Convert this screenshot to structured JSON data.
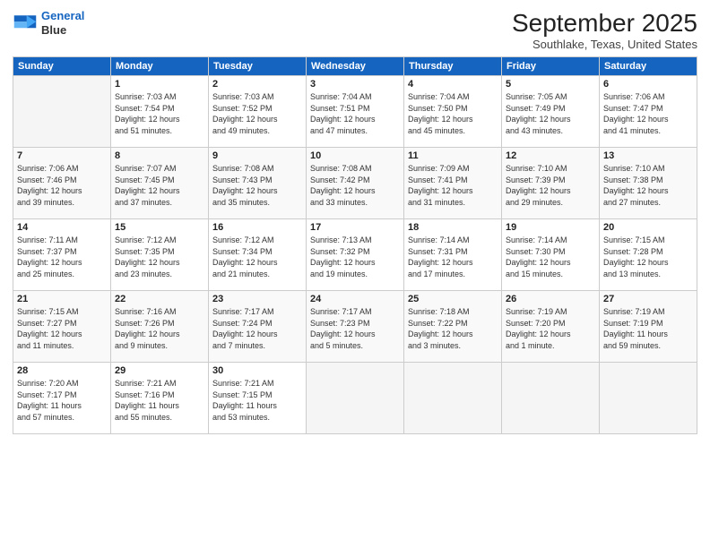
{
  "header": {
    "logo_line1": "General",
    "logo_line2": "Blue",
    "month_title": "September 2025",
    "location": "Southlake, Texas, United States"
  },
  "days_of_week": [
    "Sunday",
    "Monday",
    "Tuesday",
    "Wednesday",
    "Thursday",
    "Friday",
    "Saturday"
  ],
  "weeks": [
    [
      {
        "day": "",
        "info": ""
      },
      {
        "day": "1",
        "info": "Sunrise: 7:03 AM\nSunset: 7:54 PM\nDaylight: 12 hours\nand 51 minutes."
      },
      {
        "day": "2",
        "info": "Sunrise: 7:03 AM\nSunset: 7:52 PM\nDaylight: 12 hours\nand 49 minutes."
      },
      {
        "day": "3",
        "info": "Sunrise: 7:04 AM\nSunset: 7:51 PM\nDaylight: 12 hours\nand 47 minutes."
      },
      {
        "day": "4",
        "info": "Sunrise: 7:04 AM\nSunset: 7:50 PM\nDaylight: 12 hours\nand 45 minutes."
      },
      {
        "day": "5",
        "info": "Sunrise: 7:05 AM\nSunset: 7:49 PM\nDaylight: 12 hours\nand 43 minutes."
      },
      {
        "day": "6",
        "info": "Sunrise: 7:06 AM\nSunset: 7:47 PM\nDaylight: 12 hours\nand 41 minutes."
      }
    ],
    [
      {
        "day": "7",
        "info": "Sunrise: 7:06 AM\nSunset: 7:46 PM\nDaylight: 12 hours\nand 39 minutes."
      },
      {
        "day": "8",
        "info": "Sunrise: 7:07 AM\nSunset: 7:45 PM\nDaylight: 12 hours\nand 37 minutes."
      },
      {
        "day": "9",
        "info": "Sunrise: 7:08 AM\nSunset: 7:43 PM\nDaylight: 12 hours\nand 35 minutes."
      },
      {
        "day": "10",
        "info": "Sunrise: 7:08 AM\nSunset: 7:42 PM\nDaylight: 12 hours\nand 33 minutes."
      },
      {
        "day": "11",
        "info": "Sunrise: 7:09 AM\nSunset: 7:41 PM\nDaylight: 12 hours\nand 31 minutes."
      },
      {
        "day": "12",
        "info": "Sunrise: 7:10 AM\nSunset: 7:39 PM\nDaylight: 12 hours\nand 29 minutes."
      },
      {
        "day": "13",
        "info": "Sunrise: 7:10 AM\nSunset: 7:38 PM\nDaylight: 12 hours\nand 27 minutes."
      }
    ],
    [
      {
        "day": "14",
        "info": "Sunrise: 7:11 AM\nSunset: 7:37 PM\nDaylight: 12 hours\nand 25 minutes."
      },
      {
        "day": "15",
        "info": "Sunrise: 7:12 AM\nSunset: 7:35 PM\nDaylight: 12 hours\nand 23 minutes."
      },
      {
        "day": "16",
        "info": "Sunrise: 7:12 AM\nSunset: 7:34 PM\nDaylight: 12 hours\nand 21 minutes."
      },
      {
        "day": "17",
        "info": "Sunrise: 7:13 AM\nSunset: 7:32 PM\nDaylight: 12 hours\nand 19 minutes."
      },
      {
        "day": "18",
        "info": "Sunrise: 7:14 AM\nSunset: 7:31 PM\nDaylight: 12 hours\nand 17 minutes."
      },
      {
        "day": "19",
        "info": "Sunrise: 7:14 AM\nSunset: 7:30 PM\nDaylight: 12 hours\nand 15 minutes."
      },
      {
        "day": "20",
        "info": "Sunrise: 7:15 AM\nSunset: 7:28 PM\nDaylight: 12 hours\nand 13 minutes."
      }
    ],
    [
      {
        "day": "21",
        "info": "Sunrise: 7:15 AM\nSunset: 7:27 PM\nDaylight: 12 hours\nand 11 minutes."
      },
      {
        "day": "22",
        "info": "Sunrise: 7:16 AM\nSunset: 7:26 PM\nDaylight: 12 hours\nand 9 minutes."
      },
      {
        "day": "23",
        "info": "Sunrise: 7:17 AM\nSunset: 7:24 PM\nDaylight: 12 hours\nand 7 minutes."
      },
      {
        "day": "24",
        "info": "Sunrise: 7:17 AM\nSunset: 7:23 PM\nDaylight: 12 hours\nand 5 minutes."
      },
      {
        "day": "25",
        "info": "Sunrise: 7:18 AM\nSunset: 7:22 PM\nDaylight: 12 hours\nand 3 minutes."
      },
      {
        "day": "26",
        "info": "Sunrise: 7:19 AM\nSunset: 7:20 PM\nDaylight: 12 hours\nand 1 minute."
      },
      {
        "day": "27",
        "info": "Sunrise: 7:19 AM\nSunset: 7:19 PM\nDaylight: 11 hours\nand 59 minutes."
      }
    ],
    [
      {
        "day": "28",
        "info": "Sunrise: 7:20 AM\nSunset: 7:17 PM\nDaylight: 11 hours\nand 57 minutes."
      },
      {
        "day": "29",
        "info": "Sunrise: 7:21 AM\nSunset: 7:16 PM\nDaylight: 11 hours\nand 55 minutes."
      },
      {
        "day": "30",
        "info": "Sunrise: 7:21 AM\nSunset: 7:15 PM\nDaylight: 11 hours\nand 53 minutes."
      },
      {
        "day": "",
        "info": ""
      },
      {
        "day": "",
        "info": ""
      },
      {
        "day": "",
        "info": ""
      },
      {
        "day": "",
        "info": ""
      }
    ]
  ]
}
